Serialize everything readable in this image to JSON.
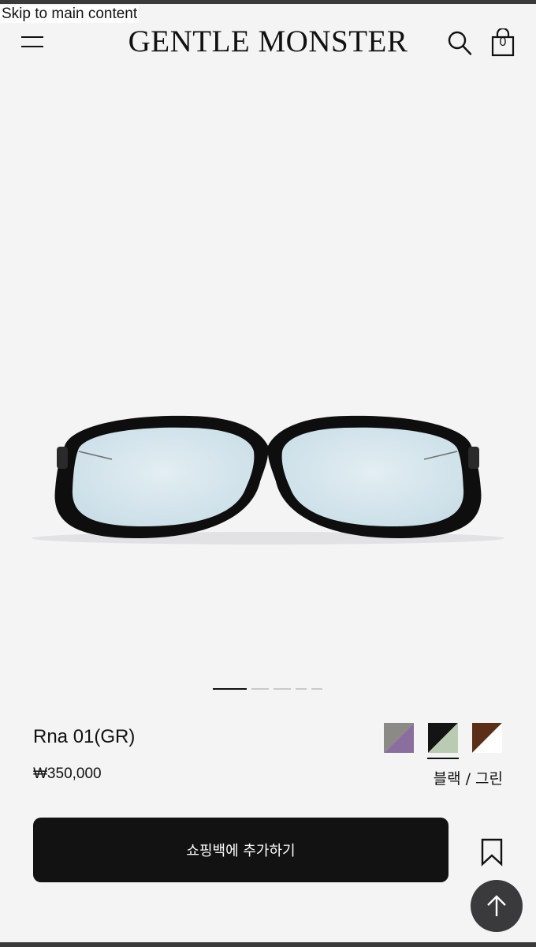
{
  "skip_link": "Skip to main content",
  "header": {
    "logo": "GENTLE MONSTER",
    "bag_count": "0",
    "icons": [
      "menu-icon",
      "search-icon",
      "shopping-bag-icon"
    ]
  },
  "gallery": {
    "slide_count": 5,
    "active_slide": 1
  },
  "product": {
    "name": "Rna 01(GR)",
    "price": "₩350,000",
    "selected_color": "블랙 / 그린",
    "swatches": [
      {
        "name": "swatch-grey-purple",
        "colors": [
          "#8c8a86",
          "#8a6f9e"
        ],
        "selected": false
      },
      {
        "name": "swatch-black-green",
        "colors": [
          "#141414",
          "#b9ccb3"
        ],
        "selected": true
      },
      {
        "name": "swatch-brown-white",
        "colors": [
          "#5a2e17",
          "#ffffff"
        ],
        "selected": false
      }
    ]
  },
  "actions": {
    "add_to_bag": "쇼핑백에 추가하기",
    "icons": [
      "bookmark-icon",
      "arrow-up-icon"
    ]
  },
  "colors": {
    "background": "#f4f4f5",
    "button": "#121212",
    "scroll_top": "#3a3a3c",
    "lens_tint": "#d5e6ee"
  }
}
